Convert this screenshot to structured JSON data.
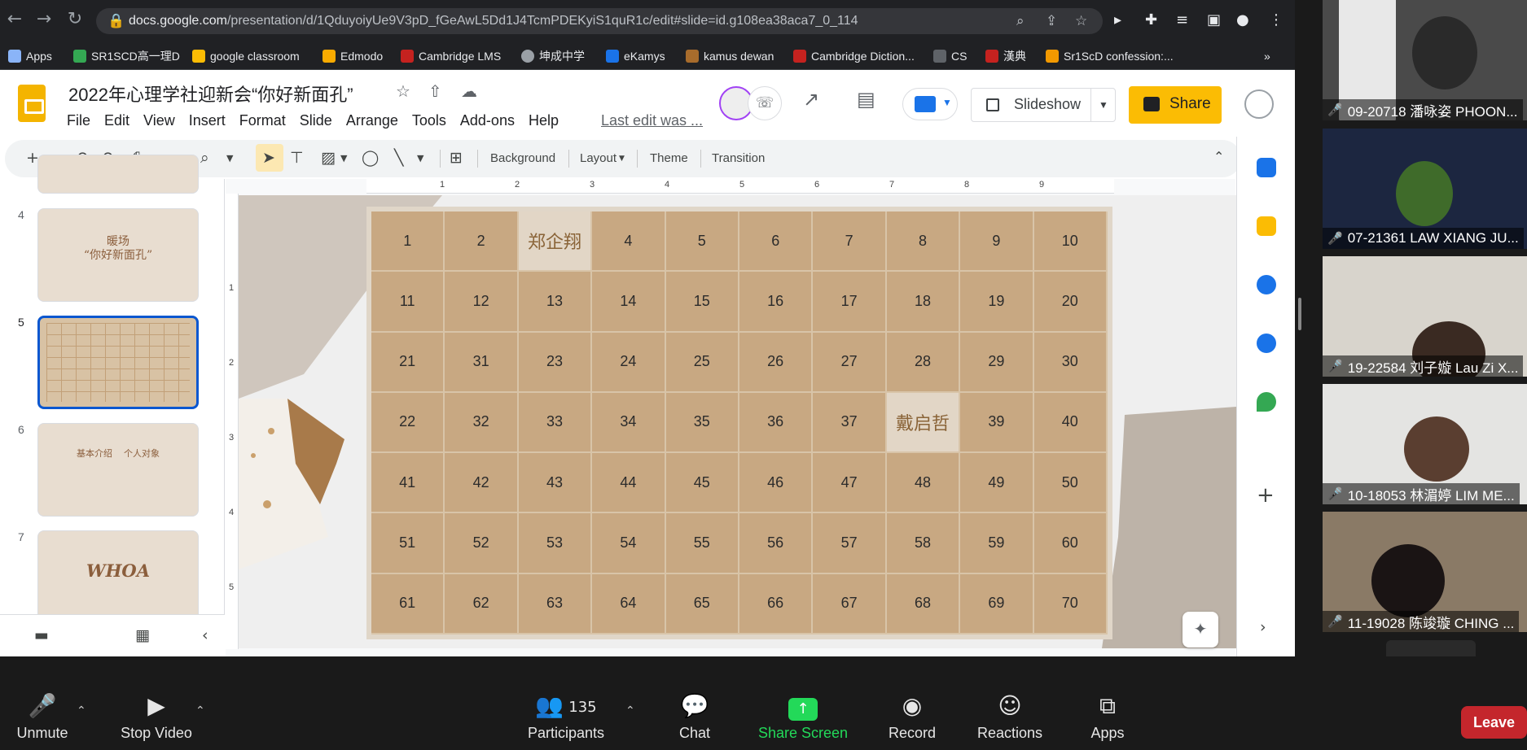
{
  "browser": {
    "url_host": "docs.google.com",
    "url_path": "/presentation/d/1QduyoiyUe9V3pD_fGeAwL5Dd1J4TcmPDEKyiS1quR1c/edit#slide=id.g108ea38aca7_0_114",
    "bookmarks": [
      {
        "label": "Apps",
        "color": "#8ab4f8"
      },
      {
        "label": "SR1SCD高一理D",
        "color": "#34a853"
      },
      {
        "label": "google classroom",
        "color": "#fbbc04"
      },
      {
        "label": "Edmodo",
        "color": "#f9ab00"
      },
      {
        "label": "Cambridge LMS",
        "color": "#c5221f"
      },
      {
        "label": "坤成中学",
        "color": "#9aa0a6"
      },
      {
        "label": "eKamys",
        "color": "#1a73e8"
      },
      {
        "label": "kamus dewan",
        "color": "#a86c2c"
      },
      {
        "label": "Cambridge Diction...",
        "color": "#c5221f"
      },
      {
        "label": "CS",
        "color": "#e8eaed"
      },
      {
        "label": "漢典",
        "color": "#c5221f"
      },
      {
        "label": "Sr1ScD confession:...",
        "color": "#f29900"
      }
    ],
    "more_bookmarks": "»"
  },
  "docs": {
    "title": "2022年心理学社迎新会“你好新面孔”",
    "menu": [
      "File",
      "Edit",
      "View",
      "Insert",
      "Format",
      "Slide",
      "Arrange",
      "Tools",
      "Add-ons",
      "Help"
    ],
    "last_edit": "Last edit was ...",
    "slideshow_label": "Slideshow",
    "share_label": "Share"
  },
  "toolbar": {
    "background": "Background",
    "layout": "Layout",
    "theme": "Theme",
    "transition": "Transition"
  },
  "ruler_h": [
    "1",
    "2",
    "3",
    "4",
    "5",
    "6",
    "7",
    "8",
    "9"
  ],
  "ruler_v": [
    "1",
    "2",
    "3",
    "4",
    "5"
  ],
  "filmstrip": [
    {
      "num": "4",
      "title": "暖场\n“你好新面孔”"
    },
    {
      "num": "5",
      "title": ""
    },
    {
      "num": "6",
      "title": "基本介绍    个人对象"
    },
    {
      "num": "7",
      "title": "WHOA"
    }
  ],
  "grid": {
    "cells": [
      "1",
      "2",
      "郑企翔",
      "4",
      "5",
      "6",
      "7",
      "8",
      "9",
      "10",
      "11",
      "12",
      "13",
      "14",
      "15",
      "16",
      "17",
      "18",
      "19",
      "20",
      "21",
      "31",
      "23",
      "24",
      "25",
      "26",
      "27",
      "28",
      "29",
      "30",
      "22",
      "32",
      "33",
      "34",
      "35",
      "36",
      "37",
      "戴启哲",
      "39",
      "40",
      "41",
      "42",
      "43",
      "44",
      "45",
      "46",
      "47",
      "48",
      "49",
      "50",
      "51",
      "52",
      "53",
      "54",
      "55",
      "56",
      "57",
      "58",
      "59",
      "60",
      "61",
      "62",
      "63",
      "64",
      "65",
      "66",
      "67",
      "68",
      "69",
      "70"
    ],
    "cell_color": "#c8a882",
    "highlight_color": "#e2d6c6"
  },
  "zoom": {
    "unmute": "Unmute",
    "stop_video": "Stop Video",
    "participants": "Participants",
    "participants_count": "135",
    "chat": "Chat",
    "share_screen": "Share Screen",
    "record": "Record",
    "reactions": "Reactions",
    "apps": "Apps",
    "leave": "Leave"
  },
  "video_tiles": [
    {
      "name": "09-20718 潘咏姿 PHOON..."
    },
    {
      "name": "07-21361 LAW XIANG JU..."
    },
    {
      "name": "19-22584 刘子嫙 Lau Zi X..."
    },
    {
      "name": "10-18053 林湄婷 LIM  ME..."
    },
    {
      "name": "11-19028 陈竣璇 CHING ..."
    }
  ]
}
